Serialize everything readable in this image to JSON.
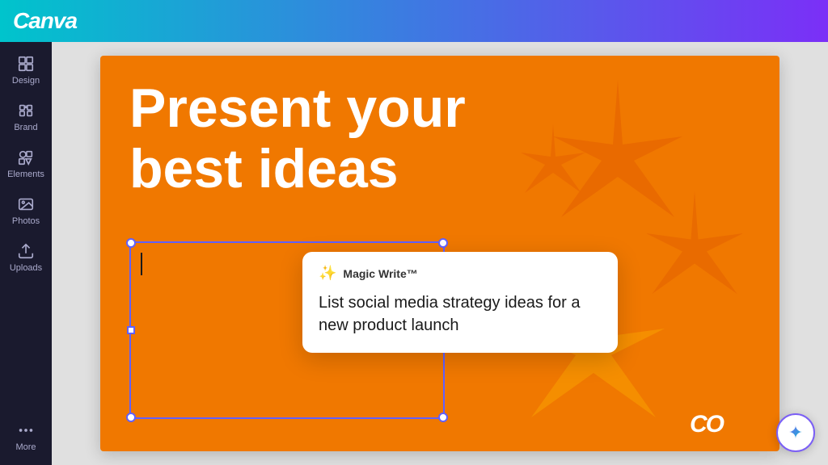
{
  "header": {
    "logo": "Canva"
  },
  "sidebar": {
    "items": [
      {
        "id": "design",
        "label": "Design",
        "icon": "layout-icon"
      },
      {
        "id": "brand",
        "label": "Brand",
        "icon": "brand-icon"
      },
      {
        "id": "elements",
        "label": "Elements",
        "icon": "elements-icon"
      },
      {
        "id": "photos",
        "label": "Photos",
        "icon": "photos-icon"
      },
      {
        "id": "uploads",
        "label": "Uploads",
        "icon": "uploads-icon"
      },
      {
        "id": "more",
        "label": "More",
        "icon": "more-icon"
      }
    ]
  },
  "slide": {
    "headline_line1": "Present your",
    "headline_line2": "best ideas",
    "background_color": "#f07800",
    "co_logo": "CO"
  },
  "magic_write": {
    "title": "Magic Write™",
    "prompt": "List social media strategy ideas for a new product launch"
  },
  "magic_button": {
    "icon": "sparkle-icon"
  }
}
